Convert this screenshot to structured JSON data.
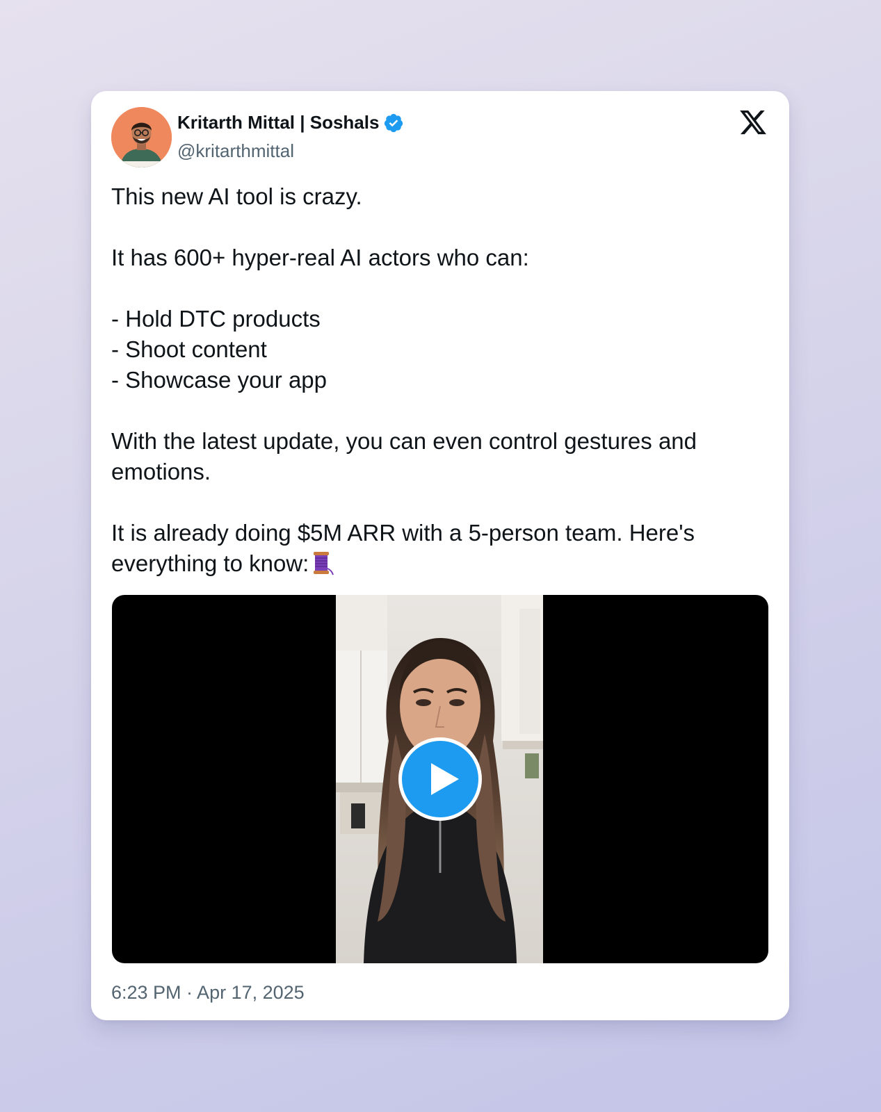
{
  "author": {
    "display_name": "Kritarth Mittal | Soshals",
    "handle": "@kritarthmittal",
    "verified": true
  },
  "tweet": {
    "lines": {
      "l1": "This new AI tool is crazy.",
      "l2": "It has 600+ hyper-real AI actors who can:",
      "l3": "- Hold DTC products",
      "l4": "- Shoot content",
      "l5": "- Showcase your app",
      "l6": "With the latest update, you can even control gestures and",
      "l7": "emotions.",
      "l8": "It is already doing $5M ARR with a 5-person team. Here's",
      "l9": "everything to know:"
    },
    "emoji": "thread-spool-icon"
  },
  "media": {
    "type": "video",
    "control": "play-icon"
  },
  "timestamp": "6:23 PM · Apr 17, 2025",
  "colors": {
    "accent": "#1d9bf0",
    "text": "#0f1419",
    "secondary_text": "#536471",
    "avatar_bg": "#f0885e"
  },
  "platform_logo": "x-logo-icon"
}
